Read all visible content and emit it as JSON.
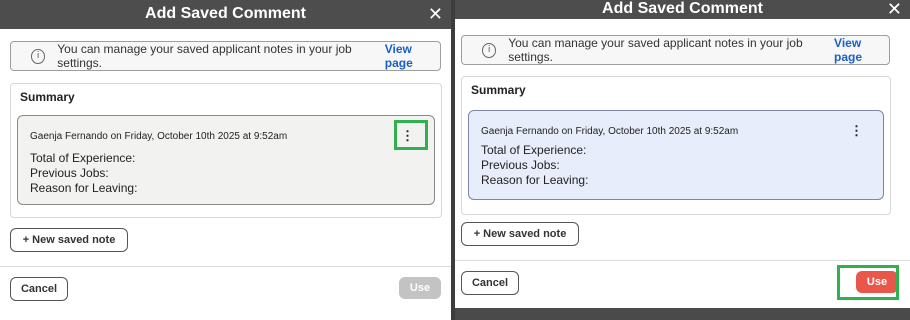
{
  "dialog": {
    "title": "Add Saved Comment",
    "close_glyph": "✕",
    "info_text": "You can manage your saved applicant notes in your job settings.",
    "info_link": "View page",
    "info_glyph": "i",
    "section_title": "Summary",
    "note": {
      "author_line": "Gaenja Fernando on Friday, October 10th 2025 at 9:52am",
      "lines": [
        "Total of Experience:",
        "Previous Jobs:",
        "Reason for Leaving:"
      ],
      "menu_glyph": "⋮"
    },
    "new_note_label": "+ New saved note",
    "cancel_label": "Cancel",
    "use_label": "Use"
  },
  "colors": {
    "header_bg": "#4d4d4d",
    "link": "#1b5fc7",
    "note_selected_bg": "#e8edfb",
    "use_enabled": "#e8574a",
    "use_disabled": "#c3c3c3",
    "highlight": "#2fb14f"
  }
}
